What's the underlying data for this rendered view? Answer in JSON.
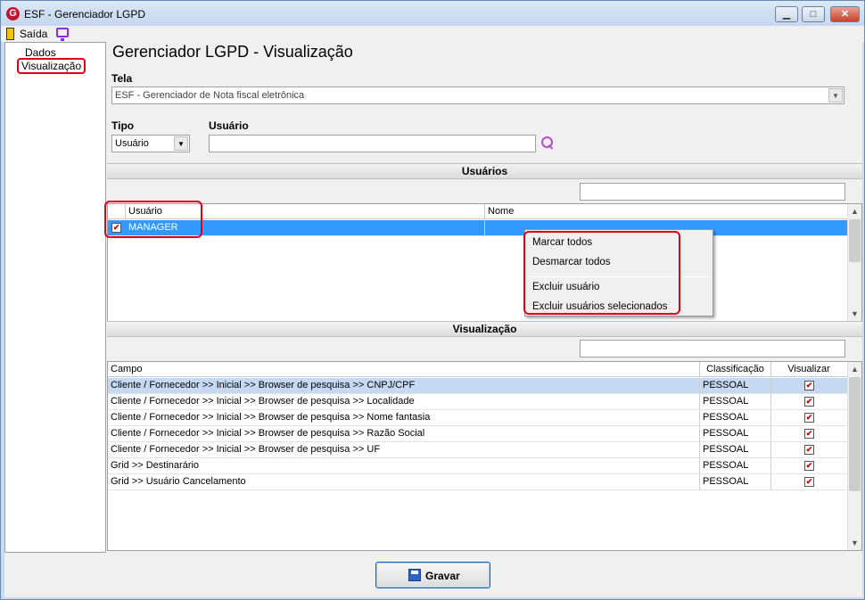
{
  "window": {
    "title": "ESF - Gerenciador LGPD",
    "logo_letter": "G",
    "minimize": "▁",
    "maximize": "□",
    "close": "✕"
  },
  "menubar": {
    "exit_label": "Saída"
  },
  "sidebar": {
    "items": [
      {
        "label": "Dados"
      },
      {
        "label": "Visualização",
        "selected": true
      }
    ]
  },
  "page_title": "Gerenciador LGPD - Visualização",
  "tela": {
    "label": "Tela",
    "value": "ESF - Gerenciador de Nota fiscal eletrônica"
  },
  "tipo": {
    "label": "Tipo",
    "value": "Usuário"
  },
  "usuario_field": {
    "label": "Usuário",
    "value": ""
  },
  "users_section": {
    "header": "Usuários",
    "search_value": "",
    "columns": [
      "Usuário",
      "Nome"
    ],
    "rows": [
      {
        "checked": true,
        "usuario": "MANAGER",
        "nome": ""
      }
    ]
  },
  "context_menu": {
    "items": [
      "Marcar todos",
      "Desmarcar todos",
      "Excluir usuário",
      "Excluir usuários selecionados"
    ]
  },
  "view_section": {
    "header": "Visualização",
    "search_value": "",
    "columns": [
      "Campo",
      "Classificação",
      "Visualizar"
    ],
    "rows": [
      {
        "campo": "Cliente / Fornecedor >> Inicial >> Browser de pesquisa >> CNPJ/CPF",
        "classificacao": "PESSOAL",
        "visualizar": true
      },
      {
        "campo": "Cliente / Fornecedor >> Inicial >> Browser de pesquisa >> Localidade",
        "classificacao": "PESSOAL",
        "visualizar": true
      },
      {
        "campo": "Cliente / Fornecedor >> Inicial >> Browser de pesquisa >> Nome fantasia",
        "classificacao": "PESSOAL",
        "visualizar": true
      },
      {
        "campo": "Cliente / Fornecedor >> Inicial >> Browser de pesquisa >> Razão Social",
        "classificacao": "PESSOAL",
        "visualizar": true
      },
      {
        "campo": "Cliente / Fornecedor >> Inicial >> Browser de pesquisa >> UF",
        "classificacao": "PESSOAL",
        "visualizar": true
      },
      {
        "campo": "Grid >> Destinarário",
        "classificacao": "PESSOAL",
        "visualizar": true
      },
      {
        "campo": "Grid >> Usuário Cancelamento",
        "classificacao": "PESSOAL",
        "visualizar": true
      }
    ]
  },
  "save_button": {
    "label": "Gravar"
  },
  "colors": {
    "selection": "#3399ff",
    "row_highlight": "#c6d9f3",
    "callout": "#e0001a",
    "search_icon": "#b44fd0"
  }
}
